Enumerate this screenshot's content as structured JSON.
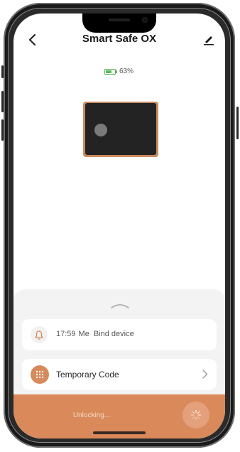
{
  "header": {
    "title": "Smart Safe OX",
    "back_icon": "chevron-left-icon",
    "edit_icon": "pencil-icon"
  },
  "battery": {
    "level_percent": 63,
    "label": "63%",
    "color": "#5cb85c"
  },
  "device_image": {
    "icon": "safe-icon",
    "body_color": "#232323",
    "trim_color": "#c98a5e"
  },
  "sheet": {
    "handle_icon": "chevron-up-icon",
    "log": {
      "icon": "bell-icon",
      "time": "17:59",
      "user": "Me",
      "action": "Bind device"
    },
    "temp_code": {
      "icon": "keypad-icon",
      "label": "Temporary Code",
      "chevron_icon": "chevron-right-icon"
    }
  },
  "unlock": {
    "status": "Unlocking...",
    "icon": "spinner-icon",
    "color": "#d9895a"
  }
}
